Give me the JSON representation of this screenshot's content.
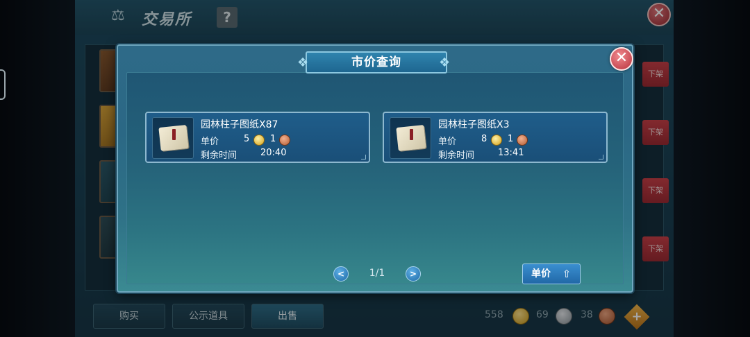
{
  "background_window": {
    "title": "交易所",
    "title_icon": "scale-icon",
    "help_label": "?",
    "delist_label": "下架",
    "tabs": [
      "购买",
      "公示道具",
      "出售"
    ],
    "active_tab": "出售",
    "currencies": [
      {
        "amount": "558",
        "type": "gold"
      },
      {
        "amount": "69",
        "type": "silver"
      },
      {
        "amount": "38",
        "type": "copper"
      }
    ],
    "add_label": "+"
  },
  "modal": {
    "title": "市价查询",
    "listings": [
      {
        "name": "园林柱子图纸X87",
        "price_label": "单价",
        "gold": "5",
        "copper": "1",
        "time_label": "剩余时间",
        "time": "20:40"
      },
      {
        "name": "园林柱子图纸X3",
        "price_label": "单价",
        "gold": "8",
        "copper": "1",
        "time_label": "剩余时间",
        "time": "13:41"
      }
    ],
    "pager": {
      "prev": "<",
      "next": ">",
      "page": "1/1"
    },
    "sort_button": {
      "label": "单价",
      "arrow": "⇧"
    }
  },
  "colors": {
    "modal_bg": "#2e6a88",
    "listing_bg": "#1f5d8a",
    "close_red": "#b8313c",
    "button_blue": "#2168a7",
    "gold": "#d4a11a",
    "copper": "#b35e35"
  }
}
